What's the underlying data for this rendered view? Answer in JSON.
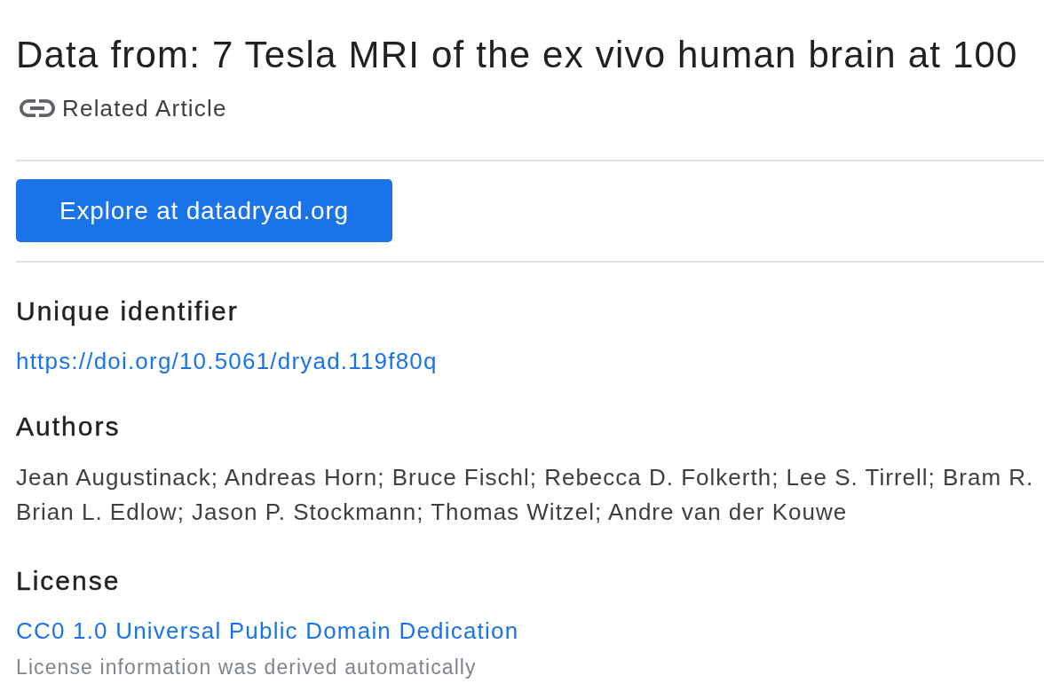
{
  "title": "Data from: 7 Tesla MRI of the ex vivo human brain at 100",
  "related_article": {
    "label": "Related Article"
  },
  "explore_button": {
    "label": "Explore at datadryad.org"
  },
  "sections": [
    {
      "kind": "link",
      "heading": "Unique identifier",
      "link": "https://doi.org/10.5061/dryad.119f80q"
    },
    {
      "kind": "text",
      "heading": "Authors",
      "lines": [
        "Jean Augustinack; Andreas Horn; Bruce Fischl; Rebecca D. Folkerth; Lee S. Tirrell; Bram R.",
        "Brian L. Edlow; Jason P. Stockmann; Thomas Witzel; Andre van der Kouwe"
      ]
    },
    {
      "kind": "link",
      "heading": "License",
      "link": "CC0 1.0 Universal Public Domain Dedication",
      "note": "License information was derived automatically"
    }
  ]
}
